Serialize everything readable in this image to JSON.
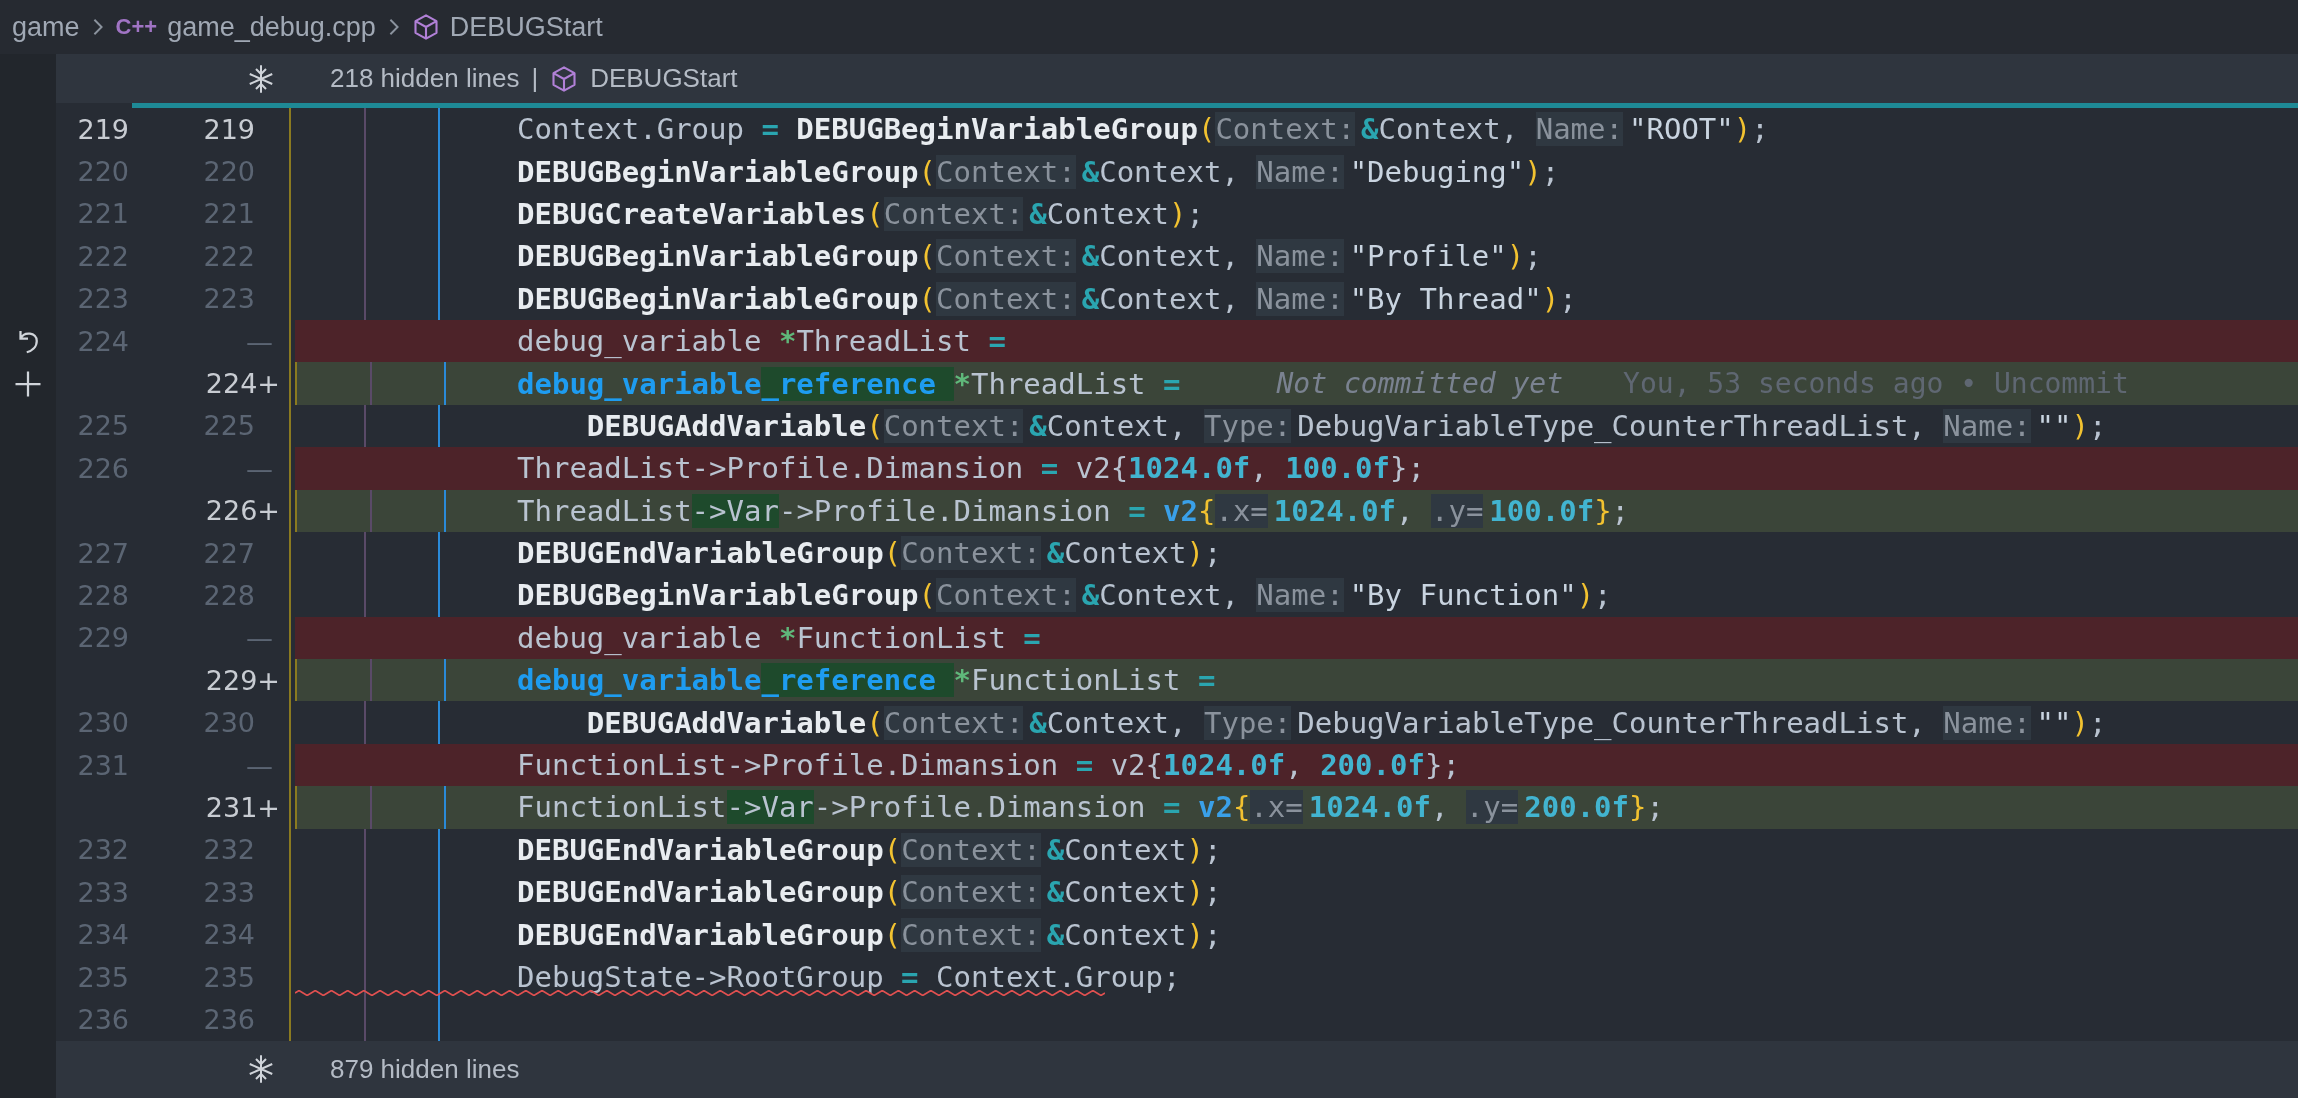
{
  "breadcrumb": [
    {
      "kind": "folder",
      "label": "game"
    },
    {
      "kind": "cpp-file",
      "icon": "C++",
      "label": "game_debug.cpp"
    },
    {
      "kind": "symbol",
      "label": "DEBUGStart"
    }
  ],
  "fold_top": {
    "label": "218 hidden lines",
    "separator": "|",
    "symbol": "DEBUGStart"
  },
  "lines": [
    {
      "kind": "context",
      "old": "219",
      "new": "219",
      "current": true,
      "error": false,
      "tokens": [
        {
          "kind": "plain",
          "s": "Context.Group ",
          "changed": false
        },
        {
          "kind": "op",
          "s": "= ",
          "changed": false
        },
        {
          "kind": "fn",
          "s": "DEBUGBeginVariableGroup",
          "changed": false
        },
        {
          "kind": "paren",
          "s": "(",
          "changed": false
        },
        {
          "kind": "hint",
          "s": "Context:",
          "changed": false
        },
        {
          "kind": "amp",
          "s": "&",
          "changed": false
        },
        {
          "kind": "plain",
          "s": "Context, ",
          "changed": false
        },
        {
          "kind": "hint",
          "s": "Name:",
          "changed": false
        },
        {
          "kind": "str",
          "s": "\"ROOT\"",
          "changed": false
        },
        {
          "kind": "paren",
          "s": ")",
          "changed": false
        },
        {
          "kind": "plain",
          "s": ";",
          "changed": false
        }
      ]
    },
    {
      "kind": "context",
      "old": "220",
      "new": "220",
      "current": false,
      "error": false,
      "tokens": [
        {
          "kind": "fn",
          "s": "DEBUGBeginVariableGroup",
          "changed": false
        },
        {
          "kind": "paren",
          "s": "(",
          "changed": false
        },
        {
          "kind": "hint",
          "s": "Context:",
          "changed": false
        },
        {
          "kind": "amp",
          "s": "&",
          "changed": false
        },
        {
          "kind": "plain",
          "s": "Context, ",
          "changed": false
        },
        {
          "kind": "hint",
          "s": "Name:",
          "changed": false
        },
        {
          "kind": "str",
          "s": "\"Debuging\"",
          "changed": false
        },
        {
          "kind": "paren",
          "s": ")",
          "changed": false
        },
        {
          "kind": "plain",
          "s": ";",
          "changed": false
        }
      ]
    },
    {
      "kind": "context",
      "old": "221",
      "new": "221",
      "current": false,
      "error": false,
      "tokens": [
        {
          "kind": "fn",
          "s": "DEBUGCreateVariables",
          "changed": false
        },
        {
          "kind": "paren",
          "s": "(",
          "changed": false
        },
        {
          "kind": "hint",
          "s": "Context:",
          "changed": false
        },
        {
          "kind": "amp",
          "s": "&",
          "changed": false
        },
        {
          "kind": "plain",
          "s": "Context",
          "changed": false
        },
        {
          "kind": "paren",
          "s": ")",
          "changed": false
        },
        {
          "kind": "plain",
          "s": ";",
          "changed": false
        }
      ]
    },
    {
      "kind": "context",
      "old": "222",
      "new": "222",
      "current": false,
      "error": false,
      "tokens": [
        {
          "kind": "fn",
          "s": "DEBUGBeginVariableGroup",
          "changed": false
        },
        {
          "kind": "paren",
          "s": "(",
          "changed": false
        },
        {
          "kind": "hint",
          "s": "Context:",
          "changed": false
        },
        {
          "kind": "amp",
          "s": "&",
          "changed": false
        },
        {
          "kind": "plain",
          "s": "Context, ",
          "changed": false
        },
        {
          "kind": "hint",
          "s": "Name:",
          "changed": false
        },
        {
          "kind": "str",
          "s": "\"Profile\"",
          "changed": false
        },
        {
          "kind": "paren",
          "s": ")",
          "changed": false
        },
        {
          "kind": "plain",
          "s": ";",
          "changed": false
        }
      ]
    },
    {
      "kind": "context",
      "old": "223",
      "new": "223",
      "current": false,
      "error": false,
      "tokens": [
        {
          "kind": "fn",
          "s": "DEBUGBeginVariableGroup",
          "changed": false
        },
        {
          "kind": "paren",
          "s": "(",
          "changed": false
        },
        {
          "kind": "hint",
          "s": "Context:",
          "changed": false
        },
        {
          "kind": "amp",
          "s": "&",
          "changed": false
        },
        {
          "kind": "plain",
          "s": "Context, ",
          "changed": false
        },
        {
          "kind": "hint",
          "s": "Name:",
          "changed": false
        },
        {
          "kind": "str",
          "s": "\"By Thread\"",
          "changed": false
        },
        {
          "kind": "paren",
          "s": ")",
          "changed": false
        },
        {
          "kind": "plain",
          "s": ";",
          "changed": false
        }
      ]
    },
    {
      "kind": "removed",
      "old": "224",
      "new": "—",
      "current": false,
      "error": false,
      "gutter": {
        "kind": "revert"
      },
      "tokens": [
        {
          "kind": "plain",
          "s": "debug_variable ",
          "changed": false
        },
        {
          "kind": "ptr",
          "s": "*",
          "changed": false
        },
        {
          "kind": "plain",
          "s": "ThreadList ",
          "changed": false
        },
        {
          "kind": "op",
          "s": "=",
          "changed": false
        }
      ]
    },
    {
      "kind": "added",
      "new": "224+",
      "current": false,
      "error": false,
      "gutter": {
        "kind": "add"
      },
      "tokens": [
        {
          "kind": "type",
          "s": "debug_variable",
          "changed": false
        },
        {
          "kind": "type",
          "s": "_reference ",
          "changed": true
        },
        {
          "kind": "ptr",
          "s": "*",
          "changed": false
        },
        {
          "kind": "plain",
          "s": "ThreadList ",
          "changed": false
        },
        {
          "kind": "op",
          "s": "=",
          "changed": false
        }
      ],
      "blame": {
        "status": "Not committed yet",
        "detail": "You, 53 seconds ago • Uncommit"
      }
    },
    {
      "kind": "context",
      "old": "225",
      "new": "225",
      "current": false,
      "error": false,
      "tokens": [
        {
          "kind": "fn",
          "s": "    DEBUGAddVariable",
          "changed": false
        },
        {
          "kind": "paren",
          "s": "(",
          "changed": false
        },
        {
          "kind": "hint",
          "s": "Context:",
          "changed": false
        },
        {
          "kind": "amp",
          "s": "&",
          "changed": false
        },
        {
          "kind": "plain",
          "s": "Context, ",
          "changed": false
        },
        {
          "kind": "hint",
          "s": "Type:",
          "changed": false
        },
        {
          "kind": "plain",
          "s": "DebugVariableType_CounterThreadList, ",
          "changed": false
        },
        {
          "kind": "hint",
          "s": "Name:",
          "changed": false
        },
        {
          "kind": "str",
          "s": "\"\"",
          "changed": false
        },
        {
          "kind": "paren",
          "s": ")",
          "changed": false
        },
        {
          "kind": "plain",
          "s": ";",
          "changed": false
        }
      ]
    },
    {
      "kind": "removed",
      "old": "226",
      "new": "—",
      "current": false,
      "error": false,
      "tokens": [
        {
          "kind": "plain",
          "s": "ThreadList->Profile.Dimansion ",
          "changed": false
        },
        {
          "kind": "op",
          "s": "=",
          "changed": false
        },
        {
          "kind": "plain",
          "s": " v2{",
          "changed": false
        },
        {
          "kind": "num",
          "s": "1024.0f",
          "changed": false
        },
        {
          "kind": "plain",
          "s": ", ",
          "changed": false
        },
        {
          "kind": "num",
          "s": "100.0f",
          "changed": false
        },
        {
          "kind": "plain",
          "s": "};",
          "changed": false
        }
      ]
    },
    {
      "kind": "added",
      "new": "226+",
      "current": false,
      "error": false,
      "tokens": [
        {
          "kind": "plain",
          "s": "ThreadList",
          "changed": false
        },
        {
          "kind": "plain",
          "s": "->Var",
          "changed": true
        },
        {
          "kind": "plain",
          "s": "->Profile.Dimansion ",
          "changed": false
        },
        {
          "kind": "op",
          "s": "= ",
          "changed": false
        },
        {
          "kind": "kw",
          "s": "v2",
          "changed": false
        },
        {
          "kind": "paren",
          "s": "{",
          "changed": false
        },
        {
          "kind": "hint",
          "s": ".x=",
          "changed": false
        },
        {
          "kind": "num",
          "s": "1024.0f",
          "changed": false
        },
        {
          "kind": "plain",
          "s": ", ",
          "changed": false
        },
        {
          "kind": "hint",
          "s": ".y=",
          "changed": false
        },
        {
          "kind": "num",
          "s": "100.0f",
          "changed": false
        },
        {
          "kind": "paren",
          "s": "}",
          "changed": false
        },
        {
          "kind": "plain",
          "s": ";",
          "changed": false
        }
      ]
    },
    {
      "kind": "context",
      "old": "227",
      "new": "227",
      "current": false,
      "error": false,
      "tokens": [
        {
          "kind": "fn",
          "s": "DEBUGEndVariableGroup",
          "changed": false
        },
        {
          "kind": "paren",
          "s": "(",
          "changed": false
        },
        {
          "kind": "hint",
          "s": "Context:",
          "changed": false
        },
        {
          "kind": "amp",
          "s": "&",
          "changed": false
        },
        {
          "kind": "plain",
          "s": "Context",
          "changed": false
        },
        {
          "kind": "paren",
          "s": ")",
          "changed": false
        },
        {
          "kind": "plain",
          "s": ";",
          "changed": false
        }
      ]
    },
    {
      "kind": "context",
      "old": "228",
      "new": "228",
      "current": false,
      "error": false,
      "tokens": [
        {
          "kind": "fn",
          "s": "DEBUGBeginVariableGroup",
          "changed": false
        },
        {
          "kind": "paren",
          "s": "(",
          "changed": false
        },
        {
          "kind": "hint",
          "s": "Context:",
          "changed": false
        },
        {
          "kind": "amp",
          "s": "&",
          "changed": false
        },
        {
          "kind": "plain",
          "s": "Context, ",
          "changed": false
        },
        {
          "kind": "hint",
          "s": "Name:",
          "changed": false
        },
        {
          "kind": "str",
          "s": "\"By Function\"",
          "changed": false
        },
        {
          "kind": "paren",
          "s": ")",
          "changed": false
        },
        {
          "kind": "plain",
          "s": ";",
          "changed": false
        }
      ]
    },
    {
      "kind": "removed",
      "old": "229",
      "new": "—",
      "current": false,
      "error": false,
      "tokens": [
        {
          "kind": "plain",
          "s": "debug_variable ",
          "changed": false
        },
        {
          "kind": "ptr",
          "s": "*",
          "changed": false
        },
        {
          "kind": "plain",
          "s": "FunctionList ",
          "changed": false
        },
        {
          "kind": "op",
          "s": "=",
          "changed": false
        }
      ]
    },
    {
      "kind": "added",
      "new": "229+",
      "current": false,
      "error": false,
      "tokens": [
        {
          "kind": "type",
          "s": "debug_variable",
          "changed": false
        },
        {
          "kind": "type",
          "s": "_reference ",
          "changed": true
        },
        {
          "kind": "ptr",
          "s": "*",
          "changed": false
        },
        {
          "kind": "plain",
          "s": "FunctionList ",
          "changed": false
        },
        {
          "kind": "op",
          "s": "=",
          "changed": false
        }
      ]
    },
    {
      "kind": "context",
      "old": "230",
      "new": "230",
      "current": false,
      "error": false,
      "tokens": [
        {
          "kind": "fn",
          "s": "    DEBUGAddVariable",
          "changed": false
        },
        {
          "kind": "paren",
          "s": "(",
          "changed": false
        },
        {
          "kind": "hint",
          "s": "Context:",
          "changed": false
        },
        {
          "kind": "amp",
          "s": "&",
          "changed": false
        },
        {
          "kind": "plain",
          "s": "Context, ",
          "changed": false
        },
        {
          "kind": "hint",
          "s": "Type:",
          "changed": false
        },
        {
          "kind": "plain",
          "s": "DebugVariableType_CounterThreadList, ",
          "changed": false
        },
        {
          "kind": "hint",
          "s": "Name:",
          "changed": false
        },
        {
          "kind": "str",
          "s": "\"\"",
          "changed": false
        },
        {
          "kind": "paren",
          "s": ")",
          "changed": false
        },
        {
          "kind": "plain",
          "s": ";",
          "changed": false
        }
      ]
    },
    {
      "kind": "removed",
      "old": "231",
      "new": "—",
      "current": false,
      "error": false,
      "tokens": [
        {
          "kind": "plain",
          "s": "FunctionList->Profile.Dimansion ",
          "changed": false
        },
        {
          "kind": "op",
          "s": "=",
          "changed": false
        },
        {
          "kind": "plain",
          "s": " v2{",
          "changed": false
        },
        {
          "kind": "num",
          "s": "1024.0f",
          "changed": false
        },
        {
          "kind": "plain",
          "s": ", ",
          "changed": false
        },
        {
          "kind": "num",
          "s": "200.0f",
          "changed": false
        },
        {
          "kind": "plain",
          "s": "};",
          "changed": false
        }
      ]
    },
    {
      "kind": "added",
      "new": "231+",
      "current": false,
      "error": false,
      "tokens": [
        {
          "kind": "plain",
          "s": "FunctionList",
          "changed": false
        },
        {
          "kind": "plain",
          "s": "->Var",
          "changed": true
        },
        {
          "kind": "plain",
          "s": "->Profile.Dimansion ",
          "changed": false
        },
        {
          "kind": "op",
          "s": "= ",
          "changed": false
        },
        {
          "kind": "kw",
          "s": "v2",
          "changed": false
        },
        {
          "kind": "paren",
          "s": "{",
          "changed": false
        },
        {
          "kind": "hint",
          "s": ".x=",
          "changed": false
        },
        {
          "kind": "num",
          "s": "1024.0f",
          "changed": false
        },
        {
          "kind": "plain",
          "s": ", ",
          "changed": false
        },
        {
          "kind": "hint",
          "s": ".y=",
          "changed": false
        },
        {
          "kind": "num",
          "s": "200.0f",
          "changed": false
        },
        {
          "kind": "paren",
          "s": "}",
          "changed": false
        },
        {
          "kind": "plain",
          "s": ";",
          "changed": false
        }
      ]
    },
    {
      "kind": "context",
      "old": "232",
      "new": "232",
      "current": false,
      "error": false,
      "tokens": [
        {
          "kind": "fn",
          "s": "DEBUGEndVariableGroup",
          "changed": false
        },
        {
          "kind": "paren",
          "s": "(",
          "changed": false
        },
        {
          "kind": "hint",
          "s": "Context:",
          "changed": false
        },
        {
          "kind": "amp",
          "s": "&",
          "changed": false
        },
        {
          "kind": "plain",
          "s": "Context",
          "changed": false
        },
        {
          "kind": "paren",
          "s": ")",
          "changed": false
        },
        {
          "kind": "plain",
          "s": ";",
          "changed": false
        }
      ]
    },
    {
      "kind": "context",
      "old": "233",
      "new": "233",
      "current": false,
      "error": false,
      "tokens": [
        {
          "kind": "fn",
          "s": "DEBUGEndVariableGroup",
          "changed": false
        },
        {
          "kind": "paren",
          "s": "(",
          "changed": false
        },
        {
          "kind": "hint",
          "s": "Context:",
          "changed": false
        },
        {
          "kind": "amp",
          "s": "&",
          "changed": false
        },
        {
          "kind": "plain",
          "s": "Context",
          "changed": false
        },
        {
          "kind": "paren",
          "s": ")",
          "changed": false
        },
        {
          "kind": "plain",
          "s": ";",
          "changed": false
        }
      ]
    },
    {
      "kind": "context",
      "old": "234",
      "new": "234",
      "current": false,
      "error": false,
      "tokens": [
        {
          "kind": "fn",
          "s": "DEBUGEndVariableGroup",
          "changed": false
        },
        {
          "kind": "paren",
          "s": "(",
          "changed": false
        },
        {
          "kind": "hint",
          "s": "Context:",
          "changed": false
        },
        {
          "kind": "amp",
          "s": "&",
          "changed": false
        },
        {
          "kind": "plain",
          "s": "Context",
          "changed": false
        },
        {
          "kind": "paren",
          "s": ")",
          "changed": false
        },
        {
          "kind": "plain",
          "s": ";",
          "changed": false
        }
      ]
    },
    {
      "kind": "context",
      "old": "235",
      "new": "235",
      "current": false,
      "error": true,
      "tokens": [
        {
          "kind": "plain",
          "s": "DebugState->RootGroup ",
          "changed": false
        },
        {
          "kind": "op",
          "s": "=",
          "changed": false
        },
        {
          "kind": "plain",
          "s": " Context.Group;",
          "changed": false
        }
      ]
    },
    {
      "kind": "context",
      "old": "236",
      "new": "236",
      "current": false,
      "error": false
    }
  ],
  "fold_bottom": {
    "label": "879 hidden lines"
  }
}
